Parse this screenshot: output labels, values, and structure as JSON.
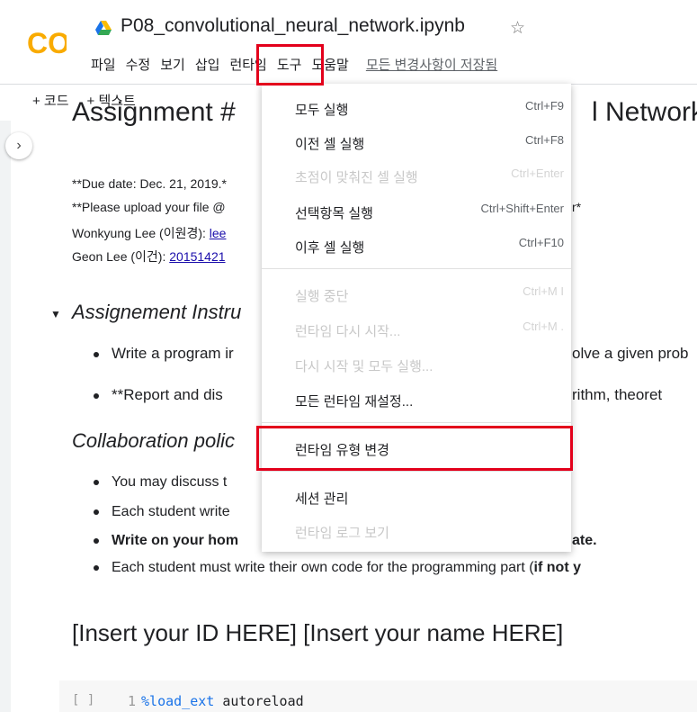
{
  "app": {
    "logo_text": "CO",
    "notebook_title": "P08_convolutional_neural_network.ipynb",
    "star_glyph": "☆",
    "colors": {
      "logo_orange": "#f9ab00",
      "highlight_red": "#e3001b"
    }
  },
  "menubar": {
    "items": [
      "파일",
      "수정",
      "보기",
      "삽입",
      "런타임",
      "도구",
      "도움말"
    ],
    "saved_status": "모든 변경사항이 저장됨"
  },
  "toolbar": {
    "add_code": "+ 코드",
    "add_text": "+ 텍스트"
  },
  "notebook": {
    "heading_left": "Assignment #",
    "heading_right": "l Network",
    "due_line": "**Due date: Dec. 21, 2019.*",
    "upload_line": "**Please upload your file @",
    "upload_tail": "r*",
    "ta1_name": "Wonkyung Lee (이원경): ",
    "ta1_link": "lee",
    "ta2_name": "Geon Lee (이건): ",
    "ta2_link": "20151421",
    "section_heading": "Assignement Instru",
    "bullet1_left": "Write a program ir",
    "bullet1_right": "olve a given prob",
    "bullet2_left": "**Report and dis",
    "bullet2_right": "rithm, theoret",
    "collab_heading": "Collaboration polic",
    "collab1": "You may discuss t",
    "collab2": "Each student write",
    "collab3_left": "Write on your hom",
    "collab3_right": "ate.",
    "collab4_main": "Each student must write their own code for the programming part (",
    "collab4_bold": "if not y",
    "insert_heading": "[Insert your ID HERE] [Insert your name HERE]",
    "code_bracket": "[ ]",
    "code_line_no": "1",
    "code_magic": "%load_ext",
    "code_arg": " autoreload"
  },
  "runtime_menu": {
    "items": [
      {
        "label": "모두 실행",
        "shortcut": "Ctrl+F9",
        "disabled": false
      },
      {
        "label": "이전 셀 실행",
        "shortcut": "Ctrl+F8",
        "disabled": false
      },
      {
        "label": "초점이 맞춰진 셀 실행",
        "shortcut": "Ctrl+Enter",
        "disabled": true
      },
      {
        "label": "선택항목 실행",
        "shortcut": "Ctrl+Shift+Enter",
        "disabled": false
      },
      {
        "label": "이후 셀 실행",
        "shortcut": "Ctrl+F10",
        "disabled": false
      },
      {
        "label": "실행 중단",
        "shortcut": "Ctrl+M I",
        "disabled": true
      },
      {
        "label": "런타임 다시 시작...",
        "shortcut": "Ctrl+M .",
        "disabled": true
      },
      {
        "label": "다시 시작 및 모두 실행...",
        "shortcut": "",
        "disabled": true
      },
      {
        "label": "모든 런타임 재설정...",
        "shortcut": "",
        "disabled": false
      },
      {
        "label": "런타임 유형 변경",
        "shortcut": "",
        "disabled": false
      },
      {
        "label": "세션 관리",
        "shortcut": "",
        "disabled": false
      },
      {
        "label": "런타임 로그 보기",
        "shortcut": "",
        "disabled": true
      }
    ]
  }
}
